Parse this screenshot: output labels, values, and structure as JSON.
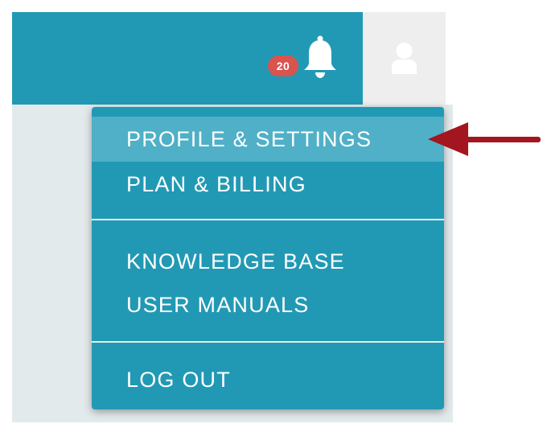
{
  "header": {
    "notifications": {
      "count": "20",
      "icon": "bell-icon"
    },
    "user_menu": {
      "icon": "user-icon"
    }
  },
  "menu": {
    "items": [
      {
        "label": "PROFILE & SETTINGS",
        "highlighted": true
      },
      {
        "label": "PLAN & BILLING"
      },
      {
        "label": "KNOWLEDGE BASE"
      },
      {
        "label": "USER MANUALS"
      },
      {
        "label": "LOG OUT"
      }
    ]
  },
  "colors": {
    "header_bg": "#2299b4",
    "menu_bg": "#2299b4",
    "menu_highlight": "#4fb0c7",
    "badge": "#d9534f",
    "arrow": "#a3161f",
    "avatar_bg": "#eeeeee"
  }
}
